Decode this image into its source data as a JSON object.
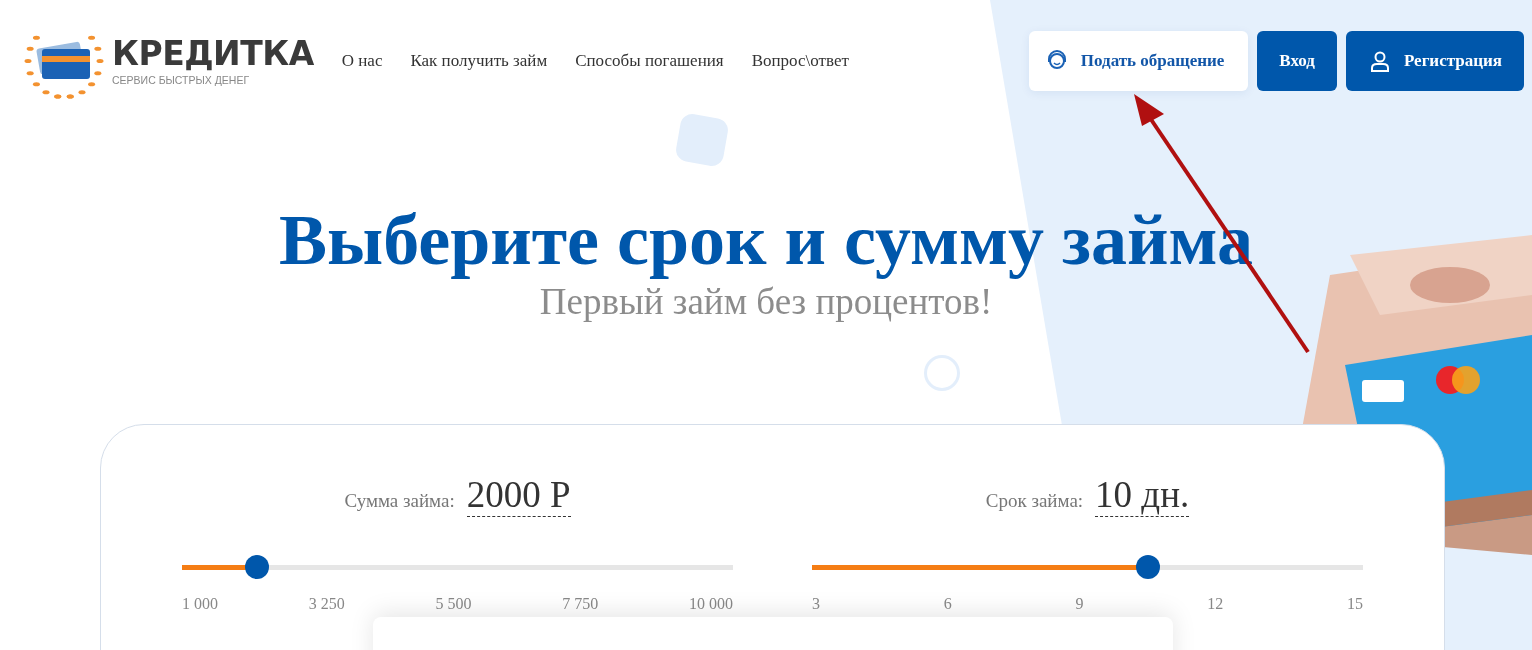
{
  "logo": {
    "name": "КРЕДИТКА",
    "tagline": "СЕРВИС БЫСТРЫХ ДЕНЕГ"
  },
  "nav": [
    {
      "label": "О нас"
    },
    {
      "label": "Как получить займ"
    },
    {
      "label": "Способы погашения"
    },
    {
      "label": "Вопрос\\ответ"
    }
  ],
  "header_buttons": [
    {
      "kind": "support",
      "label": "Подать обращение"
    },
    {
      "kind": "login",
      "label": "Вход"
    },
    {
      "kind": "register",
      "label": "Регистрация"
    }
  ],
  "hero": {
    "title": "Выберите срок и сумму займа",
    "subtitle": "Первый займ без процентов!"
  },
  "calculator": {
    "sliders": [
      {
        "label": "Сумма займа:",
        "value": "2000 Р",
        "level": 0.13,
        "ticks": [
          "1 000",
          "3 250",
          "5 500",
          "7 750",
          "10 000"
        ]
      },
      {
        "label": "Срок займа:",
        "value": "10 дн.",
        "level": 0.58,
        "ticks": [
          "3",
          "6",
          "9",
          "12",
          "15"
        ]
      }
    ]
  }
}
